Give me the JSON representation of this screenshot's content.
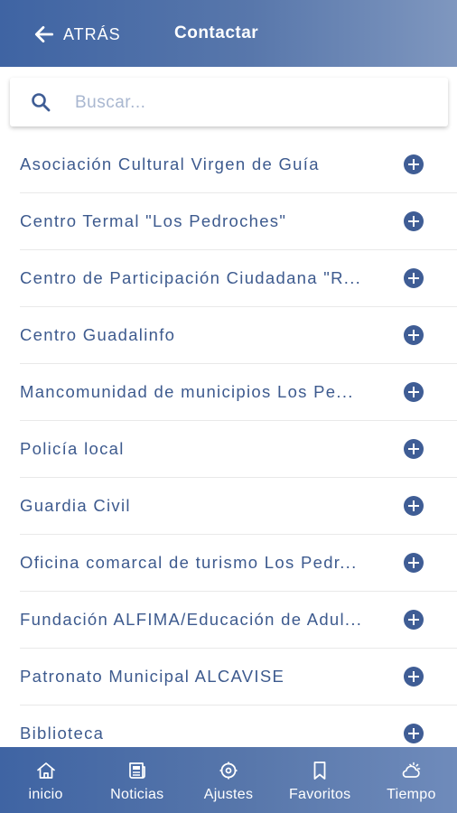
{
  "header": {
    "back_label": "ATRÁS",
    "title": "Contactar"
  },
  "search": {
    "placeholder": "Buscar...",
    "value": ""
  },
  "contacts": [
    {
      "label": "Asociación Cultural Virgen de Guía"
    },
    {
      "label": "Centro Termal \"Los Pedroches\""
    },
    {
      "label": "Centro de Participación Ciudadana \"R..."
    },
    {
      "label": "Centro Guadalinfo"
    },
    {
      "label": "Mancomunidad de municipios Los Pe..."
    },
    {
      "label": "Policía local"
    },
    {
      "label": "Guardia Civil"
    },
    {
      "label": "Oficina comarcal de turismo Los Pedr..."
    },
    {
      "label": "Fundación ALFIMA/Educación de Adul..."
    },
    {
      "label": "Patronato Municipal ALCAVISE"
    },
    {
      "label": "Biblioteca"
    }
  ],
  "nav": {
    "items": [
      {
        "label": "inicio",
        "icon": "home-icon"
      },
      {
        "label": "Noticias",
        "icon": "newspaper-icon"
      },
      {
        "label": "Ajustes",
        "icon": "settings-icon"
      },
      {
        "label": "Favoritos",
        "icon": "bookmark-icon"
      },
      {
        "label": "Tiempo",
        "icon": "weather-icon"
      }
    ]
  },
  "colors": {
    "header_bg": "#3f64a3",
    "accent": "#3f5d95",
    "text": "#3d5a8e"
  }
}
